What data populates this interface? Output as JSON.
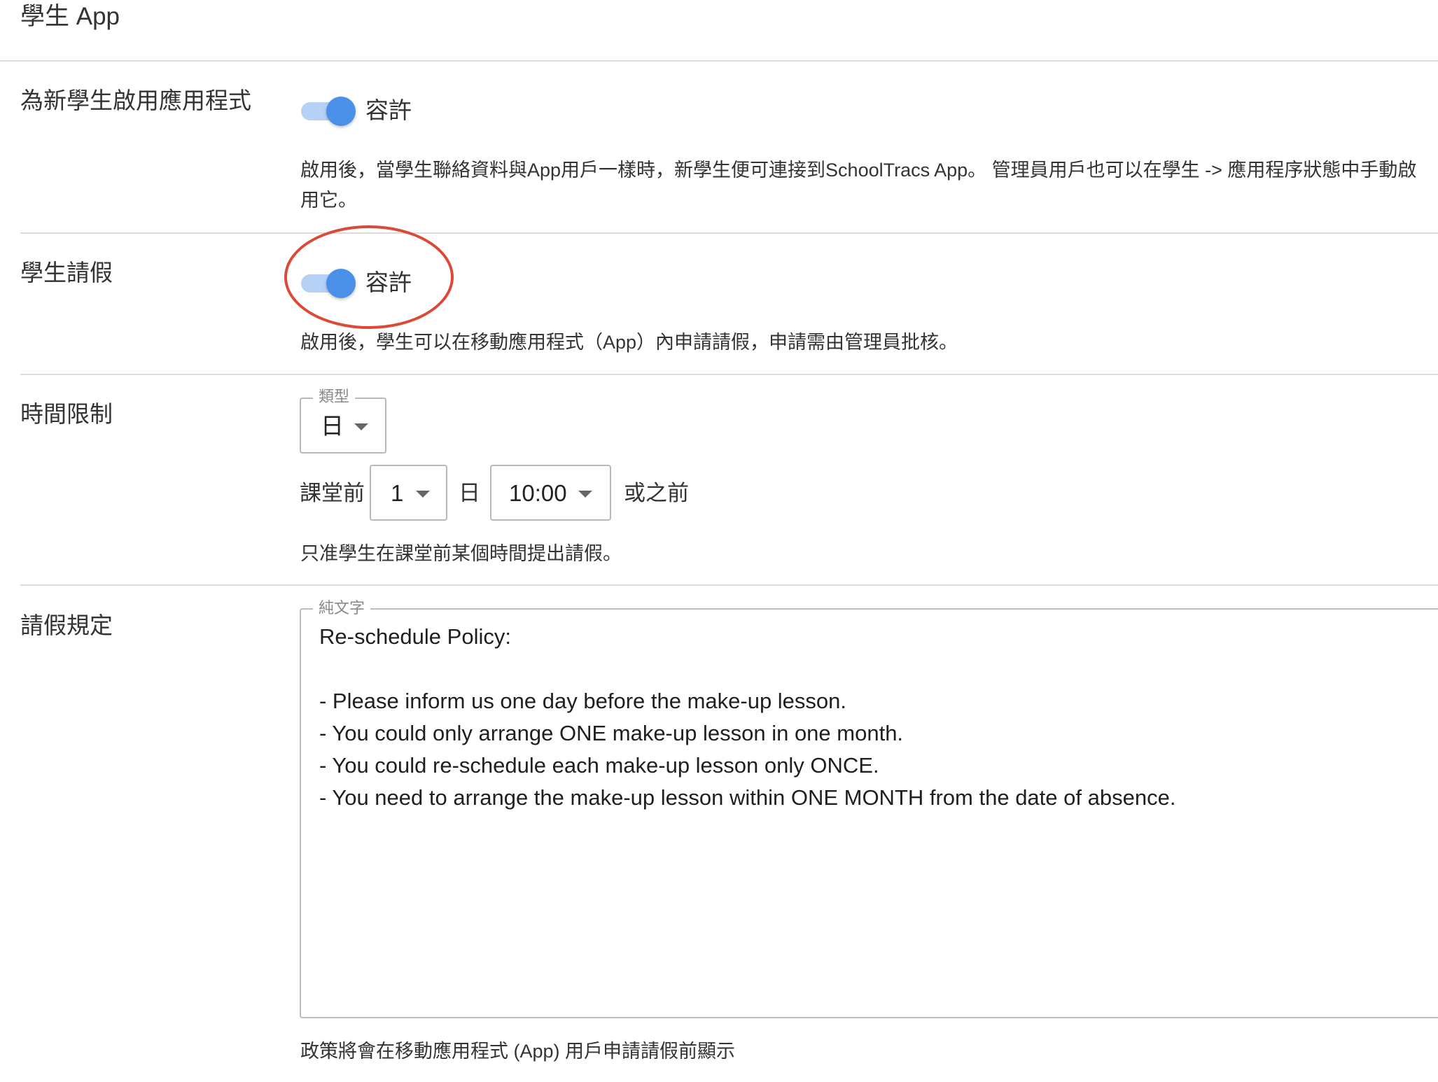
{
  "page_title": "學生 App",
  "enable_new_students": {
    "label": "為新學生啟用應用程式",
    "toggle_label": "容許",
    "description_line1": "啟用後，當學生聯絡資料與App用戶一樣時，新學生便可連接到SchoolTracs App。 管理員用戶也可以在學生 -> 應用程序狀態中手動啟",
    "description_line2": "用它。",
    "enabled": true
  },
  "student_leave": {
    "label": "學生請假",
    "toggle_label": "容許",
    "description": "啟用後，學生可以在移動應用程式（App）內申請請假，申請需由管理員批核。",
    "enabled": true
  },
  "time_limit": {
    "label": "時間限制",
    "type_legend": "類型",
    "type_value": "日",
    "prefix": "課堂前",
    "days_value": "1",
    "days_unit": "日",
    "time_value": "10:00",
    "suffix": "或之前",
    "description": "只准學生在課堂前某個時間提出請假。"
  },
  "leave_policy": {
    "label": "請假規定",
    "legend": "純文字",
    "text": "Re-schedule Policy:\n\n- Please inform us one day before the make-up lesson.\n- You could only arrange ONE make-up lesson in one month.\n- You could re-schedule each make-up lesson only ONCE.\n- You need to arrange the make-up lesson within ONE MONTH from the date of absence.",
    "footer": "政策將會在移動應用程式 (App) 用戶申請請假前顯示"
  },
  "colors": {
    "toggle_on": "#4a90e8",
    "toggle_track": "#b5d2f6",
    "annotation": "#db4a37",
    "divider": "#dcdcdc"
  }
}
